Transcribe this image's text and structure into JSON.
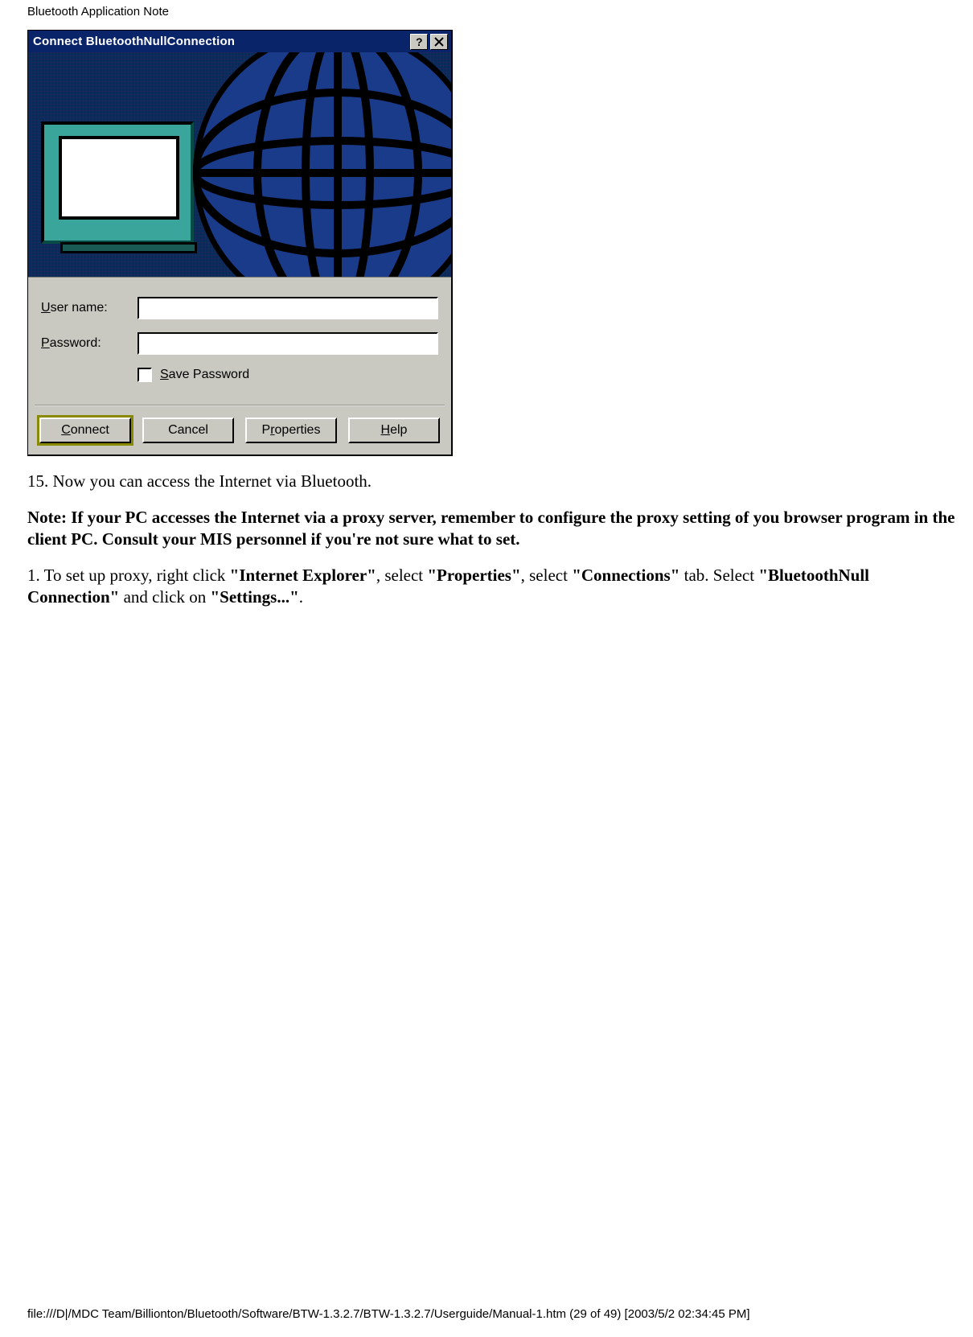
{
  "header": {
    "title": "Bluetooth Application Note"
  },
  "dialog": {
    "title": "Connect BluetoothNullConnection",
    "labels": {
      "username_pre": "U",
      "username_post": "ser name:",
      "password_pre": "P",
      "password_post": "assword:",
      "save_pre": "S",
      "save_post": "ave Password"
    },
    "fields": {
      "username": "",
      "password": ""
    },
    "buttons": {
      "connect_pre": "C",
      "connect_post": "onnect",
      "cancel": "Cancel",
      "properties_pre": "P",
      "properties_mid": "r",
      "properties_post": "operties",
      "help_pre": "H",
      "help_post": "elp"
    }
  },
  "body": {
    "step15": "15. Now you can access the Internet via Bluetooth.",
    "note": "Note: If your PC accesses the Internet via a proxy server, remember to configure the proxy setting of you browser program in the client PC. Consult your MIS personnel if you're not sure what to set.",
    "proxy_1a": "1. To set up proxy, right click ",
    "proxy_ie": "\"Internet Explorer\"",
    "proxy_1b": ", select ",
    "proxy_props": "\"Properties\"",
    "proxy_1c": ", select ",
    "proxy_conn": "\"Connections\"",
    "proxy_1d": " tab. Select ",
    "proxy_btnull": "\"BluetoothNull Connection\"",
    "proxy_1e": " and click on ",
    "proxy_settings": "\"Settings...\"",
    "proxy_1f": "."
  },
  "footer": {
    "path": "file:///D|/MDC Team/Billionton/Bluetooth/Software/BTW-1.3.2.7/BTW-1.3.2.7/Userguide/Manual-1.htm (29 of 49) [2003/5/2 02:34:45 PM]"
  }
}
